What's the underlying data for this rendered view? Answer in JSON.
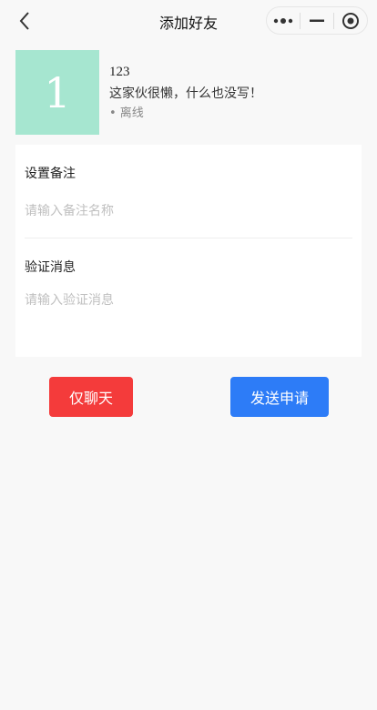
{
  "nav": {
    "title": "添加好友"
  },
  "profile": {
    "avatar_text": "1",
    "name": "123",
    "signature": "这家伙很懒，什么也没写！",
    "status": "• 离线"
  },
  "form": {
    "remark_label": "设置备注",
    "remark_placeholder": "请输入备注名称",
    "message_label": "验证消息",
    "message_placeholder": "请输入验证消息"
  },
  "actions": {
    "chat_only_label": "仅聊天",
    "send_request_label": "发送申请"
  },
  "colors": {
    "avatar_bg": "#a6e6d0",
    "chat_button": "#f43b3b",
    "send_button": "#2d7cf7",
    "page_bg": "#f8f8f8"
  }
}
